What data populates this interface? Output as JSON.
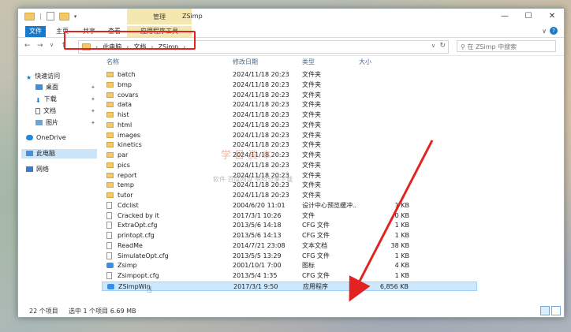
{
  "window": {
    "title": "ZSimp",
    "context_tab": "管理",
    "controls": [
      "—",
      "☐",
      "✕"
    ]
  },
  "ribbon": {
    "file": "文件",
    "tabs": [
      "主页",
      "共享",
      "查看",
      "应用程序工具"
    ],
    "help": "?"
  },
  "address": {
    "crumbs": [
      "此电脑",
      "文档",
      "ZSimp"
    ],
    "search_placeholder": "在 ZSimp 中搜索"
  },
  "sidebar": {
    "items": [
      {
        "label": "快速访问",
        "icon": "star-icon",
        "pin": false
      },
      {
        "label": "桌面",
        "icon": "desktop-icon",
        "pin": true
      },
      {
        "label": "下载",
        "icon": "download-icon",
        "pin": true
      },
      {
        "label": "文档",
        "icon": "document-icon",
        "pin": true
      },
      {
        "label": "图片",
        "icon": "picture-icon",
        "pin": true
      },
      {
        "label": "OneDrive",
        "icon": "cloud-icon",
        "pin": false
      },
      {
        "label": "此电脑",
        "icon": "pc-icon",
        "pin": false
      },
      {
        "label": "网络",
        "icon": "network-icon",
        "pin": false
      }
    ]
  },
  "columns": [
    "名称",
    "修改日期",
    "类型",
    "大小"
  ],
  "files": [
    {
      "name": "batch",
      "date": "2024/11/18 20:23",
      "type": "文件夹",
      "size": "",
      "kind": "folder"
    },
    {
      "name": "bmp",
      "date": "2024/11/18 20:23",
      "type": "文件夹",
      "size": "",
      "kind": "folder"
    },
    {
      "name": "covars",
      "date": "2024/11/18 20:23",
      "type": "文件夹",
      "size": "",
      "kind": "folder"
    },
    {
      "name": "data",
      "date": "2024/11/18 20:23",
      "type": "文件夹",
      "size": "",
      "kind": "folder"
    },
    {
      "name": "hist",
      "date": "2024/11/18 20:23",
      "type": "文件夹",
      "size": "",
      "kind": "folder"
    },
    {
      "name": "html",
      "date": "2024/11/18 20:23",
      "type": "文件夹",
      "size": "",
      "kind": "folder"
    },
    {
      "name": "images",
      "date": "2024/11/18 20:23",
      "type": "文件夹",
      "size": "",
      "kind": "folder"
    },
    {
      "name": "kinetics",
      "date": "2024/11/18 20:23",
      "type": "文件夹",
      "size": "",
      "kind": "folder"
    },
    {
      "name": "par",
      "date": "2024/11/18 20:23",
      "type": "文件夹",
      "size": "",
      "kind": "folder"
    },
    {
      "name": "pics",
      "date": "2024/11/18 20:23",
      "type": "文件夹",
      "size": "",
      "kind": "folder"
    },
    {
      "name": "report",
      "date": "2024/11/18 20:23",
      "type": "文件夹",
      "size": "",
      "kind": "folder"
    },
    {
      "name": "temp",
      "date": "2024/11/18 20:23",
      "type": "文件夹",
      "size": "",
      "kind": "folder"
    },
    {
      "name": "tutor",
      "date": "2024/11/18 20:23",
      "type": "文件夹",
      "size": "",
      "kind": "folder"
    },
    {
      "name": "Cdclist",
      "date": "2004/6/20 11:01",
      "type": "设计中心预览缓冲...",
      "size": "1 KB",
      "kind": "file"
    },
    {
      "name": "Cracked by it",
      "date": "2017/3/1 10:26",
      "type": "文件",
      "size": "0 KB",
      "kind": "file"
    },
    {
      "name": "ExtraOpt.cfg",
      "date": "2013/5/6 14:18",
      "type": "CFG 文件",
      "size": "1 KB",
      "kind": "file"
    },
    {
      "name": "printopt.cfg",
      "date": "2013/5/6 14:13",
      "type": "CFG 文件",
      "size": "1 KB",
      "kind": "file"
    },
    {
      "name": "ReadMe",
      "date": "2014/7/21 23:08",
      "type": "文本文档",
      "size": "38 KB",
      "kind": "file"
    },
    {
      "name": "SimulateOpt.cfg",
      "date": "2013/5/5 13:29",
      "type": "CFG 文件",
      "size": "1 KB",
      "kind": "file"
    },
    {
      "name": "Zsimp",
      "date": "2001/10/1 7:00",
      "type": "图标",
      "size": "4 KB",
      "kind": "app"
    },
    {
      "name": "Zsimpopt.cfg",
      "date": "2013/5/4 1:35",
      "type": "CFG 文件",
      "size": "1 KB",
      "kind": "file"
    },
    {
      "name": "ZSimpWin",
      "date": "2017/3/1 9:50",
      "type": "应用程序",
      "size": "6,856 KB",
      "kind": "app",
      "selected": true
    }
  ],
  "status": {
    "count": "22 个项目",
    "selected": "选中 1 个项目 6.69 MB"
  },
  "watermark": {
    "line1": "学 目 资 本",
    "line2": "软件 百度网盘 资料分享下载"
  }
}
